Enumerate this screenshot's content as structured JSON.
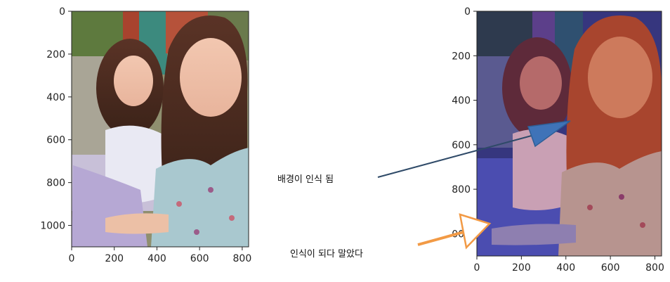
{
  "chart_data": [
    {
      "type": "image",
      "panel": "left",
      "title": "",
      "xlabel": "",
      "ylabel": "",
      "xlim": [
        0,
        830
      ],
      "ylim": [
        1100,
        0
      ],
      "x_ticks": [
        0,
        200,
        400,
        600,
        800
      ],
      "y_ticks": [
        0,
        200,
        400,
        600,
        800,
        1000
      ],
      "grid": false,
      "image_description": "original photo"
    },
    {
      "type": "image",
      "panel": "right",
      "title": "",
      "xlabel": "",
      "ylabel": "",
      "xlim": [
        0,
        830
      ],
      "ylim": [
        1100,
        0
      ],
      "x_ticks": [
        0,
        200,
        400,
        600,
        800
      ],
      "y_ticks": [
        0,
        200,
        400,
        600,
        800,
        1000
      ],
      "y_ticks_shown": [
        "0",
        "200",
        "400",
        "600",
        "800",
        "000"
      ],
      "grid": false,
      "image_description": "segmentation overlay: blue background, red foreground"
    }
  ],
  "annotations": {
    "background_label": "배경이 인식 됨",
    "partial_label": "인식이 되다 말았다"
  },
  "colors": {
    "overlay_blue": "#3f3fa0",
    "overlay_red": "#c04a3a",
    "arrow_blue": "#2e5f96",
    "arrow_dark": "#2f4a68",
    "arrow_orange": "#f29a45"
  }
}
